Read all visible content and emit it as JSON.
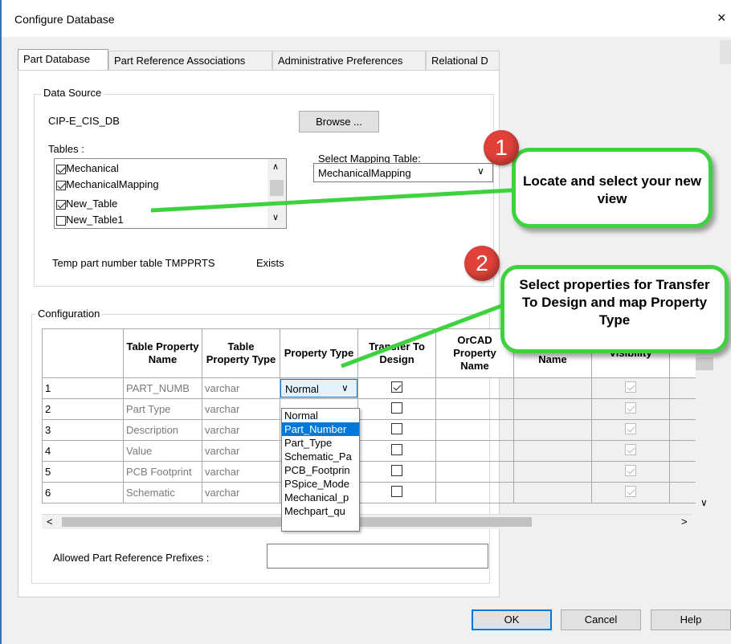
{
  "window": {
    "title": "Configure Database",
    "close": "×"
  },
  "tabs": [
    "Part Database",
    "Part Reference Associations",
    "Administrative Preferences",
    "Relational D"
  ],
  "data_source": {
    "legend": "Data Source",
    "name": "CIP-E_CIS_DB",
    "browse_label": "Browse ...",
    "tables_label": "Tables :",
    "tables": [
      {
        "label": "Mechanical",
        "checked": true
      },
      {
        "label": "MechanicalMapping",
        "checked": true
      },
      {
        "label": "New_Table",
        "checked": true
      },
      {
        "label": "New_Table1",
        "checked": false
      }
    ],
    "mapping_label": "Select Mapping Table:",
    "mapping_value": "MechanicalMapping",
    "temp_label": "Temp part number table TMPPRTS",
    "temp_status": "Exists"
  },
  "configuration": {
    "legend": "Configuration",
    "headers": [
      "Table Property Name",
      "Table Property Type",
      "Property Type",
      "Transfer To Design",
      "OrCAD Property Name",
      "Property Name",
      "Visibility"
    ],
    "rows": [
      {
        "num": "1",
        "name": "PART_NUMB",
        "type": "varchar",
        "ptype": "Normal",
        "transfer": true,
        "visible": true
      },
      {
        "num": "2",
        "name": "Part Type",
        "type": "varchar",
        "ptype": "",
        "transfer": false,
        "visible": false
      },
      {
        "num": "3",
        "name": "Description",
        "type": "varchar",
        "ptype": "",
        "transfer": false,
        "visible": false
      },
      {
        "num": "4",
        "name": "Value",
        "type": "varchar",
        "ptype": "",
        "transfer": false,
        "visible": false
      },
      {
        "num": "5",
        "name": "PCB Footprint",
        "type": "varchar",
        "ptype": "",
        "transfer": false,
        "visible": false
      },
      {
        "num": "6",
        "name": "Schematic",
        "type": "varchar",
        "ptype": "",
        "transfer": false,
        "visible": false
      }
    ],
    "dropdown_options": [
      "Normal",
      "Part_Number",
      "Part_Type",
      "Schematic_Pa",
      "PCB_Footprin",
      "PSpice_Mode",
      "Mechanical_p",
      "Mechpart_qu"
    ],
    "dropdown_selected": "Part_Number",
    "prefixes_label": "Allowed Part Reference Prefixes :",
    "prefixes_value": ""
  },
  "buttons": {
    "ok": "OK",
    "cancel": "Cancel",
    "help": "Help"
  },
  "callouts": [
    {
      "badge": "1",
      "text": "Locate and select your new view"
    },
    {
      "badge": "2",
      "text": "Select properties for Transfer To Design and map Property Type"
    }
  ],
  "colors": {
    "callout_border": "#3ed23e",
    "badge": "#e0423a",
    "selection": "#0078d7"
  }
}
